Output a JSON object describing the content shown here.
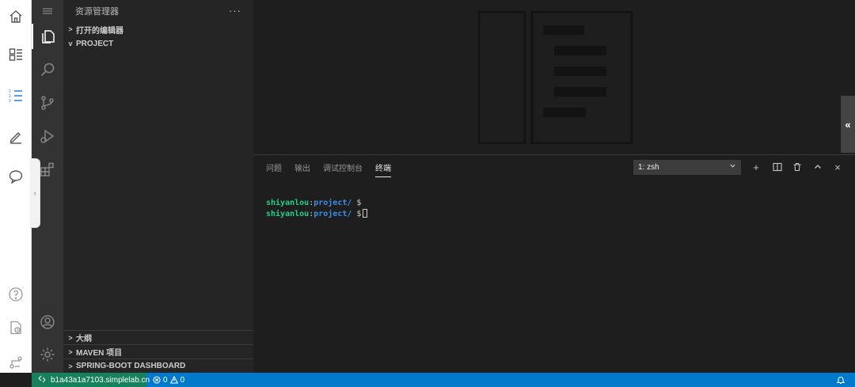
{
  "explorer": {
    "title": "资源管理器",
    "more": "···",
    "sections_top": [
      {
        "label": "打开的编辑器",
        "expanded": false
      },
      {
        "label": "PROJECT",
        "expanded": true
      }
    ],
    "sections_bottom": [
      {
        "label": "大纲",
        "expanded": false
      },
      {
        "label": "MAVEN 项目",
        "expanded": false
      },
      {
        "label": "SPRING-BOOT DASHBOARD",
        "expanded": false
      }
    ]
  },
  "panel": {
    "tabs": [
      {
        "label": "问题",
        "active": false
      },
      {
        "label": "输出",
        "active": false
      },
      {
        "label": "调试控制台",
        "active": false
      },
      {
        "label": "终端",
        "active": true
      }
    ],
    "terminal_select": "1: zsh",
    "tools": {
      "add": "+",
      "minimize": "^",
      "close": "×"
    }
  },
  "terminal": {
    "lines": [
      {
        "user": "shiyanlou",
        "colon": ":",
        "path": "project/",
        "prompt": " $"
      },
      {
        "user": "shiyanlou",
        "colon": ":",
        "path": "project/",
        "prompt": " $"
      }
    ]
  },
  "status_bar": {
    "remote_host": "b1a43a1a7103.simplelab.cn",
    "errors": "0",
    "warnings": "0"
  },
  "editor": {
    "handle": "«"
  },
  "collapse_tab": "›",
  "colors": {
    "activity_bar": "#333333",
    "sidebar": "#252526",
    "editor": "#1e1e1e",
    "status_bar": "#007acc",
    "remote": "#16825d",
    "terminal_user": "#23d18b",
    "terminal_path": "#3b8eea"
  },
  "icons": {
    "lab": [
      "home-icon",
      "course-list-icon",
      "ordered-list-icon",
      "pencil-icon",
      "chat-icon",
      "help-icon",
      "report-icon",
      "share-icon"
    ],
    "activity": [
      "menu-icon",
      "files-icon",
      "search-icon",
      "source-control-icon",
      "run-debug-icon",
      "extensions-icon",
      "account-icon",
      "settings-gear-icon"
    ]
  }
}
